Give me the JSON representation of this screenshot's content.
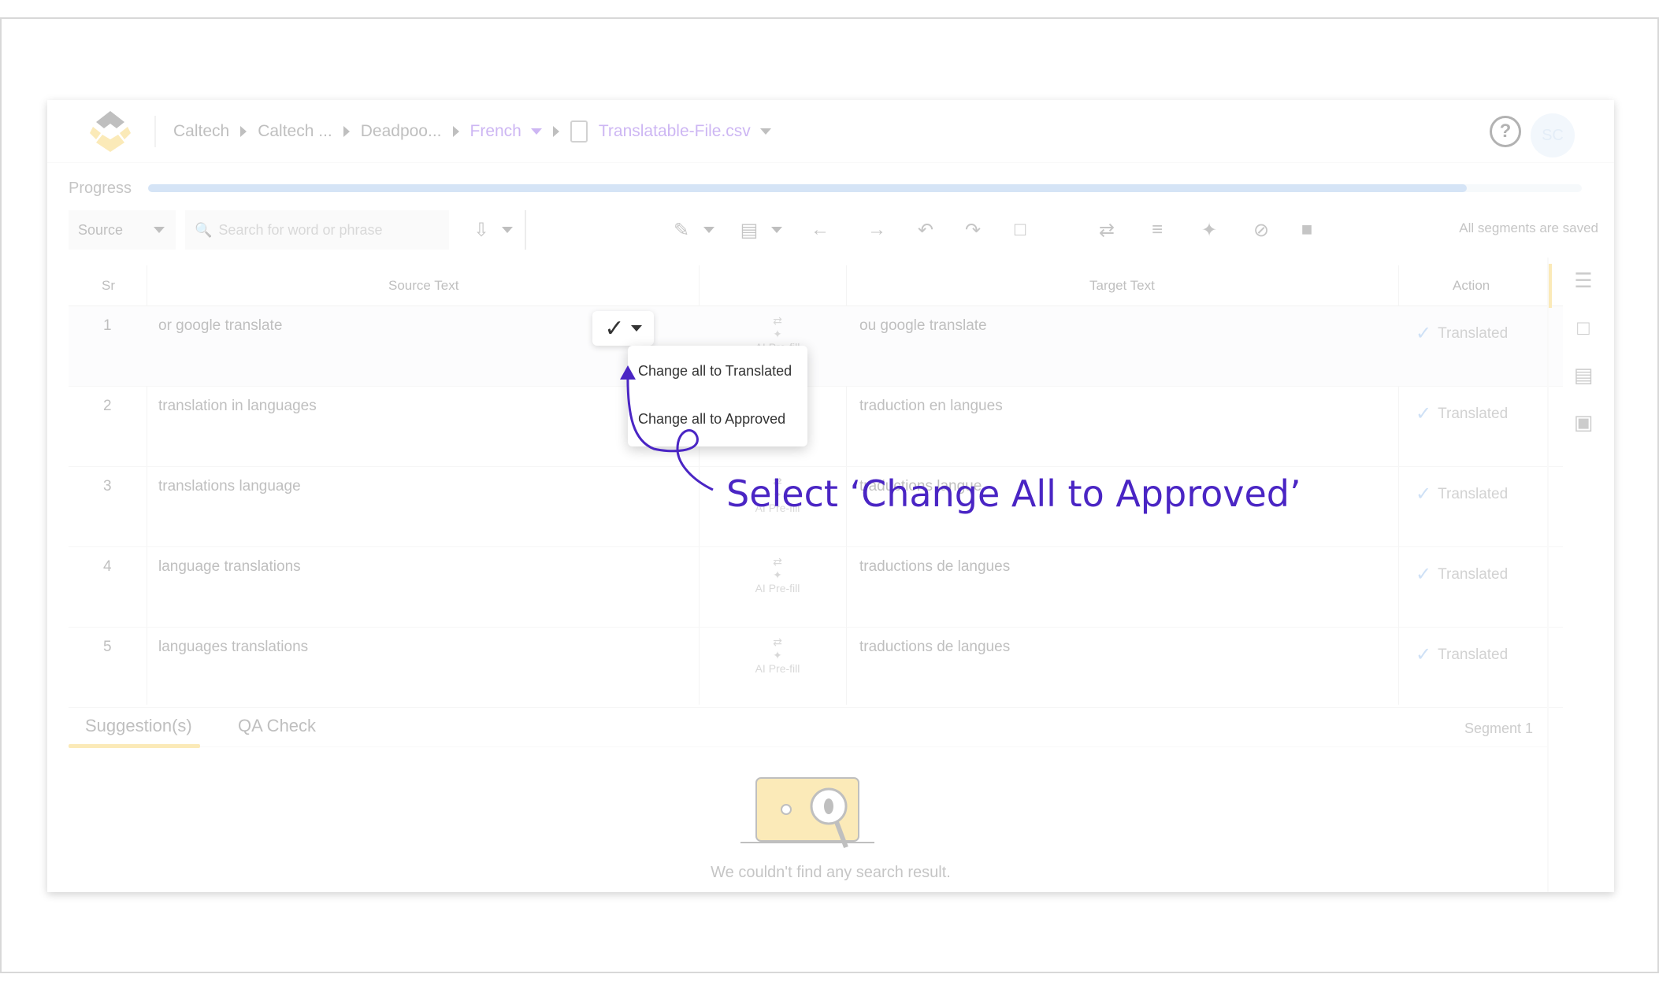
{
  "header": {
    "breadcrumbs": [
      "Caltech",
      "Caltech ...",
      "Deadpoo..."
    ],
    "language": "French",
    "file_name": "Translatable-File.csv",
    "help_symbol": "?",
    "avatar_initials": "SC"
  },
  "progress": {
    "label": "Progress",
    "value_fraction": 0.92
  },
  "toolbar": {
    "source_select": "Source",
    "search_placeholder": "Search for word or phrase",
    "save_status": "All segments are saved",
    "status_check": "✓"
  },
  "dropdown": {
    "items": [
      "Change all to Translated",
      "Change all to Approved"
    ]
  },
  "grid": {
    "headers": {
      "sr": "Sr",
      "source": "Source Text",
      "target": "Target Text",
      "action": "Action"
    },
    "ai_label": "AI Pre-fill",
    "rows": [
      {
        "sr": "1",
        "source": "or google translate",
        "target": "ou google translate",
        "status": "Translated"
      },
      {
        "sr": "2",
        "source": "translation in languages",
        "target": "traduction en langues",
        "status": "Translated"
      },
      {
        "sr": "3",
        "source": "translations language",
        "target": "traductions langue",
        "status": "Translated"
      },
      {
        "sr": "4",
        "source": "language translations",
        "target": "traductions de langues",
        "status": "Translated"
      },
      {
        "sr": "5",
        "source": "languages translations",
        "target": "traductions de langues",
        "status": "Translated"
      }
    ]
  },
  "bottom": {
    "tabs": [
      "Suggestion(s)",
      "QA Check"
    ],
    "segment_label": "Segment 1",
    "empty_message": "We couldn't find any search result."
  },
  "annotation": {
    "text": "Select ‘Change All to Approved’"
  },
  "colors": {
    "accent_purple": "#7a3ee0",
    "annotation": "#4a25c4",
    "tab_accent": "#f5c842"
  }
}
